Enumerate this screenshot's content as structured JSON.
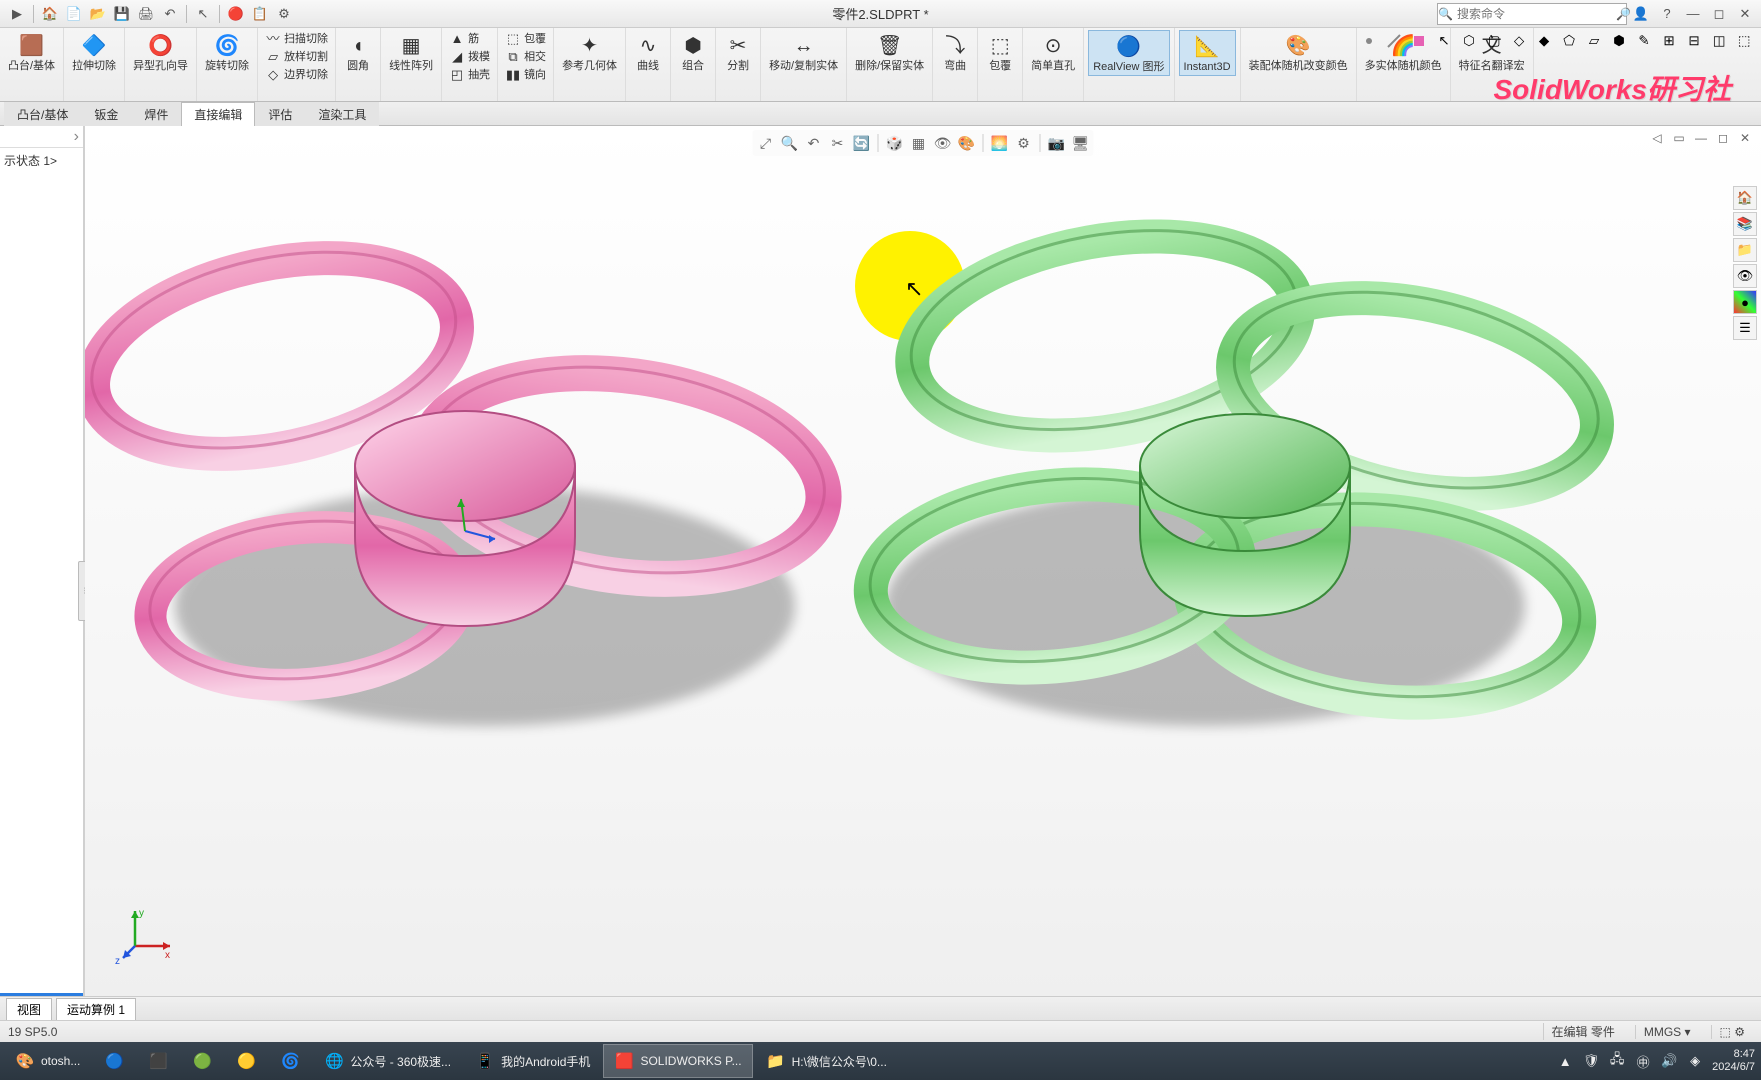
{
  "title_bar": {
    "document_title": "零件2.SLDPRT *",
    "search_placeholder": "搜索命令"
  },
  "ribbon": {
    "buttons": {
      "extruded_boss": "凸台/基体",
      "extruded_cut": "拉伸切除",
      "hole_wizard": "异型孔向导",
      "revolved_cut": "旋转切除",
      "lofted_cut": "放样切割",
      "swept_cut": "扫描切除",
      "boundary_cut": "边界切除",
      "fillet": "圆角",
      "linear_pattern": "线性阵列",
      "rib": "筋",
      "wrap": "包覆",
      "draft": "拨模",
      "intersect": "相交",
      "shell": "抽壳",
      "mirror": "镜向",
      "ref_geom": "参考几何体",
      "curves": "曲线",
      "combine": "组合",
      "split": "分割",
      "move_copy": "移动/复制实体",
      "delete_keep": "删除/保留实体",
      "deform": "弯曲",
      "wrap2": "包覆",
      "simple_hole": "简单直孔",
      "realview": "RealView 图形",
      "instant3d": "Instant3D",
      "appearance1": "装配体随机改变颜色",
      "appearance2": "多实体随机颜色",
      "translate": "特征名翻译宏"
    },
    "watermark": "SolidWorks研习社"
  },
  "tabs": [
    "凸台/基体",
    "钣金",
    "焊件",
    "直接编辑",
    "评估",
    "渲染工具"
  ],
  "left_panel": {
    "display_state": "示状态 1>"
  },
  "bottom_tabs": [
    "视图",
    "运动算例 1"
  ],
  "status": {
    "left": "19 SP5.0",
    "editing": "在编辑 零件",
    "units": "MMGS"
  },
  "taskbar": {
    "items": [
      {
        "icon": "🎨",
        "label": "otosh..."
      },
      {
        "icon": "🔵",
        "label": ""
      },
      {
        "icon": "⬛",
        "label": ""
      },
      {
        "icon": "🟢",
        "label": ""
      },
      {
        "icon": "🟡",
        "label": ""
      },
      {
        "icon": "🌀",
        "label": ""
      },
      {
        "icon": "🌐",
        "label": "公众号 - 360极速..."
      },
      {
        "icon": "📱",
        "label": "我的Android手机"
      },
      {
        "icon": "🟥",
        "label": "SOLIDWORKS P..."
      },
      {
        "icon": "📁",
        "label": "H:\\微信公众号\\0..."
      }
    ],
    "time": "8:47",
    "date": "2024/6/7"
  },
  "triad": {
    "x": "x",
    "y": "y",
    "z": "z"
  }
}
